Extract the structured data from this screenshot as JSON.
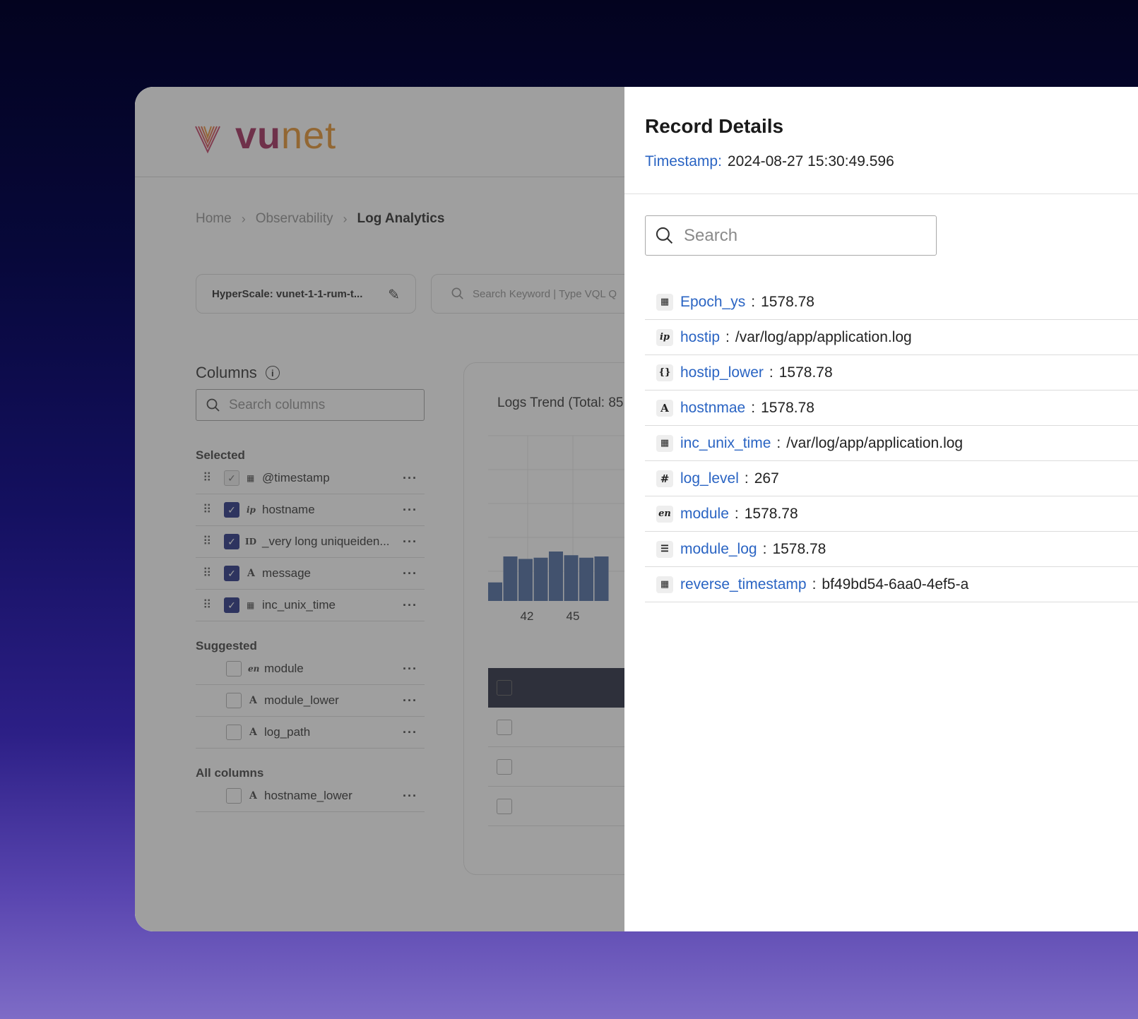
{
  "brand": {
    "logo_vu": "vu",
    "logo_net": "net"
  },
  "breadcrumb": {
    "items": [
      "Home",
      "Observability"
    ],
    "current": "Log Analytics"
  },
  "toolbar": {
    "hyperscale_label": "HyperScale: vunet-1-1-rum-t...",
    "keyword_placeholder": "Search Keyword | Type VQL Q"
  },
  "columns": {
    "title": "Columns",
    "search_placeholder": "Search columns",
    "selected_heading": "Selected",
    "selected": [
      {
        "type_icon": "calendar-icon",
        "label": "@timestamp",
        "checked": true
      },
      {
        "type_icon": "ip",
        "label": "hostname",
        "checked": true
      },
      {
        "type_icon": "ID",
        "label": "_very long uniqueiden...",
        "checked": true
      },
      {
        "type_icon": "A",
        "label": "message",
        "checked": true
      },
      {
        "type_icon": "calendar-icon",
        "label": "inc_unix_time",
        "checked": true
      }
    ],
    "suggested_heading": "Suggested",
    "suggested": [
      {
        "type_icon": "en",
        "label": "module"
      },
      {
        "type_icon": "A",
        "label": "module_lower"
      },
      {
        "type_icon": "A",
        "label": "log_path"
      }
    ],
    "all_heading": "All columns",
    "all": [
      {
        "type_icon": "A",
        "label": "hostname_lower"
      }
    ]
  },
  "chart": {
    "title": "Logs Trend (Total: 85"
  },
  "chart_data": {
    "type": "bar",
    "title": "Logs Trend (Total: 85",
    "x_tick_labels": [
      "42",
      "45"
    ],
    "values": [
      15,
      36,
      34,
      35,
      40,
      37,
      35,
      36
    ],
    "color": "#3d5f9a"
  },
  "record": {
    "title": "Record Details",
    "timestamp_key": "Timestamp:",
    "timestamp_value": "2024-08-27 15:30:49.596",
    "search_placeholder": "Search",
    "fields": [
      {
        "icon": "calendar-icon",
        "key": "Epoch_ys",
        "value": "1578.78"
      },
      {
        "icon": "ip",
        "key": "hostip",
        "value": "/var/log/app/application.log"
      },
      {
        "icon": "braces-icon",
        "key": "hostip_lower",
        "value": "1578.78"
      },
      {
        "icon": "A",
        "key": "hostnmae",
        "value": "1578.78"
      },
      {
        "icon": "calendar-icon",
        "key": "inc_unix_time",
        "value": "/var/log/app/application.log"
      },
      {
        "icon": "#",
        "key": "log_level",
        "value": "267"
      },
      {
        "icon": "en",
        "key": "module",
        "value": "1578.78"
      },
      {
        "icon": "list-icon",
        "key": "module_log",
        "value": "1578.78"
      },
      {
        "icon": "calendar-icon",
        "key": "reverse_timestamp",
        "value": "bf49bd54-6aa0-4ef5-a"
      }
    ]
  }
}
